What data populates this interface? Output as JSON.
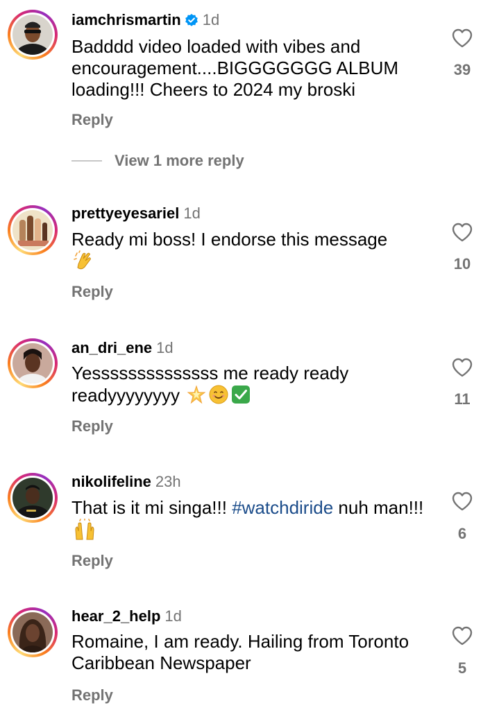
{
  "comments": [
    {
      "username": "iamchrismartin",
      "verified": true,
      "time": "1d",
      "text": "Badddd video loaded with vibes and encouragement....BIGGGGGGG ALBUM loading!!! Cheers to 2024 my broski",
      "reply_label": "Reply",
      "likes": "39",
      "view_more": "View 1 more reply"
    },
    {
      "username": "prettyeyesariel",
      "time": "1d",
      "text": "Ready mi boss! I endorse this message",
      "emojis": [
        "clapping-hands"
      ],
      "reply_label": "Reply",
      "likes": "10"
    },
    {
      "username": "an_dri_ene",
      "time": "1d",
      "text": "Yessssssssssssss me ready ready readyyyyyyyy",
      "emojis": [
        "glowing-star",
        "smiling-face",
        "check-mark"
      ],
      "reply_label": "Reply",
      "likes": "11"
    },
    {
      "username": "nikolifeline",
      "time": "23h",
      "text_before": "That is it mi singa!!! ",
      "hashtag": "#watchdiride",
      "text_after": " nuh man!!!",
      "emojis": [
        "raising-hands"
      ],
      "reply_label": "Reply",
      "likes": "6"
    },
    {
      "username": "hear_2_help",
      "time": "1d",
      "text": "Romaine, I am ready. Hailing from Toronto Caribbean Newspaper",
      "reply_label": "Reply",
      "likes": "5"
    }
  ],
  "colors": {
    "secondary_text": "#737373",
    "hashtag": "#1b4c8a",
    "verified_badge": "#0095f6"
  }
}
